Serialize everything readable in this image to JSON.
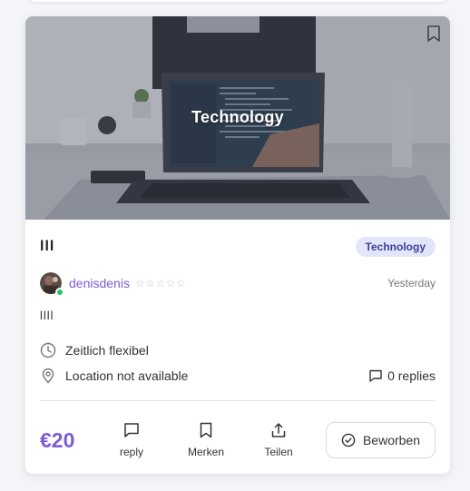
{
  "card": {
    "image_caption": "Technology",
    "title": "lll",
    "category_badge": "Technology",
    "user": {
      "name": "denisdenis",
      "rating_stars": "☆☆☆☆☆",
      "online": true
    },
    "posted": "Yesterday",
    "description": "llll",
    "schedule": "Zeitlich flexibel",
    "location": "Location not available",
    "replies": "0 replies",
    "price": "€20",
    "actions": {
      "reply": "reply",
      "save": "Merken",
      "share": "Teilen",
      "apply": "Beworben"
    }
  },
  "colors": {
    "accent": "#7c5cd6",
    "badge_bg": "#e3e6fb",
    "online": "#22c55e"
  },
  "icons": [
    "bookmark-icon",
    "clock-icon",
    "location-pin-icon",
    "comment-icon",
    "share-icon",
    "check-circle-icon"
  ]
}
